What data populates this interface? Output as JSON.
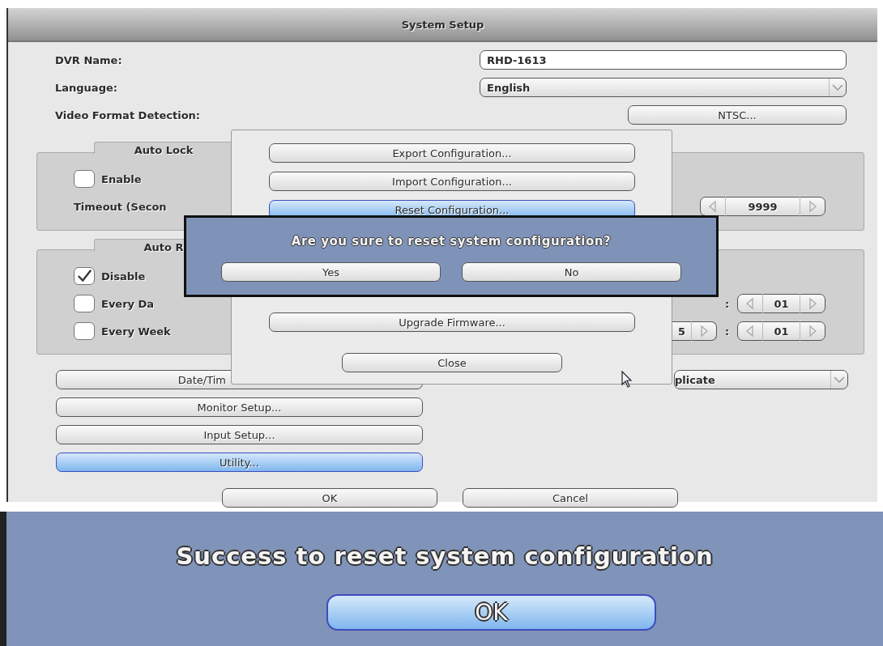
{
  "window": {
    "title": "System Setup"
  },
  "fields": [
    {
      "kind": "text",
      "label": "DVR Name:",
      "value": "RHD-1613"
    },
    {
      "kind": "dropdown",
      "label": "Language:",
      "value": "English"
    },
    {
      "kind": "button",
      "label": "Video Format Detection:",
      "value": "NTSC..."
    }
  ],
  "auto_lock": {
    "title": "Auto Lock",
    "enable": {
      "label": "Enable",
      "checked": false
    },
    "timeout_label": "Timeout (Secon",
    "timeout_value": "9999"
  },
  "auto_reboot": {
    "title": "Auto R",
    "options": [
      {
        "label": "Disable",
        "checked": true
      },
      {
        "label": "Every Da",
        "checked": false,
        "time": {
          "separator": ":",
          "minute": "01"
        }
      },
      {
        "label": "Every Week",
        "checked": false,
        "time": {
          "hour": "5",
          "separator": ":",
          "minute": "01"
        }
      }
    ]
  },
  "buttons": [
    {
      "label": "Date/Tim",
      "selected": false
    },
    {
      "label": "Monitor Setup...",
      "selected": false
    },
    {
      "label": "Input Setup...",
      "selected": false
    },
    {
      "label": "Utility...",
      "selected": true
    }
  ],
  "side_dropdown": {
    "value": "plicate"
  },
  "footer_buttons": [
    "OK",
    "Cancel"
  ],
  "utility_menu": {
    "items": [
      {
        "label": "Export Configuration...",
        "selected": false
      },
      {
        "label": "Import Configuration...",
        "selected": false
      },
      {
        "label": "Reset Configuration...",
        "selected": true
      },
      {
        "label": "Upgrade Firmware...",
        "selected": false
      }
    ],
    "close": "Close"
  },
  "confirm_dialog": {
    "message": "Are you sure to reset system configuration?",
    "buttons": [
      "Yes",
      "No"
    ]
  },
  "success_dialog": {
    "message": "Success to reset system configuration",
    "button": "OK"
  }
}
